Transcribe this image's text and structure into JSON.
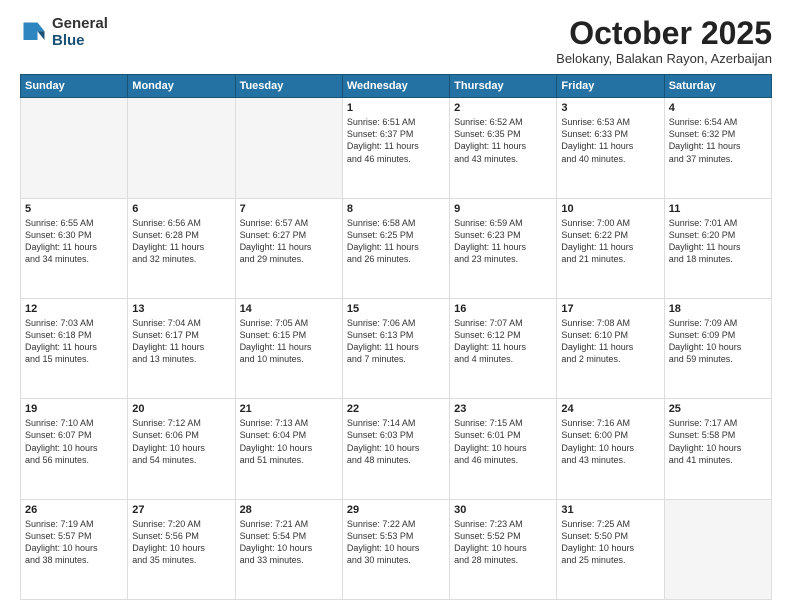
{
  "logo": {
    "general": "General",
    "blue": "Blue"
  },
  "header": {
    "month": "October 2025",
    "location": "Belokany, Balakan Rayon, Azerbaijan"
  },
  "days_of_week": [
    "Sunday",
    "Monday",
    "Tuesday",
    "Wednesday",
    "Thursday",
    "Friday",
    "Saturday"
  ],
  "weeks": [
    [
      {
        "day": "",
        "info": ""
      },
      {
        "day": "",
        "info": ""
      },
      {
        "day": "",
        "info": ""
      },
      {
        "day": "1",
        "info": "Sunrise: 6:51 AM\nSunset: 6:37 PM\nDaylight: 11 hours\nand 46 minutes."
      },
      {
        "day": "2",
        "info": "Sunrise: 6:52 AM\nSunset: 6:35 PM\nDaylight: 11 hours\nand 43 minutes."
      },
      {
        "day": "3",
        "info": "Sunrise: 6:53 AM\nSunset: 6:33 PM\nDaylight: 11 hours\nand 40 minutes."
      },
      {
        "day": "4",
        "info": "Sunrise: 6:54 AM\nSunset: 6:32 PM\nDaylight: 11 hours\nand 37 minutes."
      }
    ],
    [
      {
        "day": "5",
        "info": "Sunrise: 6:55 AM\nSunset: 6:30 PM\nDaylight: 11 hours\nand 34 minutes."
      },
      {
        "day": "6",
        "info": "Sunrise: 6:56 AM\nSunset: 6:28 PM\nDaylight: 11 hours\nand 32 minutes."
      },
      {
        "day": "7",
        "info": "Sunrise: 6:57 AM\nSunset: 6:27 PM\nDaylight: 11 hours\nand 29 minutes."
      },
      {
        "day": "8",
        "info": "Sunrise: 6:58 AM\nSunset: 6:25 PM\nDaylight: 11 hours\nand 26 minutes."
      },
      {
        "day": "9",
        "info": "Sunrise: 6:59 AM\nSunset: 6:23 PM\nDaylight: 11 hours\nand 23 minutes."
      },
      {
        "day": "10",
        "info": "Sunrise: 7:00 AM\nSunset: 6:22 PM\nDaylight: 11 hours\nand 21 minutes."
      },
      {
        "day": "11",
        "info": "Sunrise: 7:01 AM\nSunset: 6:20 PM\nDaylight: 11 hours\nand 18 minutes."
      }
    ],
    [
      {
        "day": "12",
        "info": "Sunrise: 7:03 AM\nSunset: 6:18 PM\nDaylight: 11 hours\nand 15 minutes."
      },
      {
        "day": "13",
        "info": "Sunrise: 7:04 AM\nSunset: 6:17 PM\nDaylight: 11 hours\nand 13 minutes."
      },
      {
        "day": "14",
        "info": "Sunrise: 7:05 AM\nSunset: 6:15 PM\nDaylight: 11 hours\nand 10 minutes."
      },
      {
        "day": "15",
        "info": "Sunrise: 7:06 AM\nSunset: 6:13 PM\nDaylight: 11 hours\nand 7 minutes."
      },
      {
        "day": "16",
        "info": "Sunrise: 7:07 AM\nSunset: 6:12 PM\nDaylight: 11 hours\nand 4 minutes."
      },
      {
        "day": "17",
        "info": "Sunrise: 7:08 AM\nSunset: 6:10 PM\nDaylight: 11 hours\nand 2 minutes."
      },
      {
        "day": "18",
        "info": "Sunrise: 7:09 AM\nSunset: 6:09 PM\nDaylight: 10 hours\nand 59 minutes."
      }
    ],
    [
      {
        "day": "19",
        "info": "Sunrise: 7:10 AM\nSunset: 6:07 PM\nDaylight: 10 hours\nand 56 minutes."
      },
      {
        "day": "20",
        "info": "Sunrise: 7:12 AM\nSunset: 6:06 PM\nDaylight: 10 hours\nand 54 minutes."
      },
      {
        "day": "21",
        "info": "Sunrise: 7:13 AM\nSunset: 6:04 PM\nDaylight: 10 hours\nand 51 minutes."
      },
      {
        "day": "22",
        "info": "Sunrise: 7:14 AM\nSunset: 6:03 PM\nDaylight: 10 hours\nand 48 minutes."
      },
      {
        "day": "23",
        "info": "Sunrise: 7:15 AM\nSunset: 6:01 PM\nDaylight: 10 hours\nand 46 minutes."
      },
      {
        "day": "24",
        "info": "Sunrise: 7:16 AM\nSunset: 6:00 PM\nDaylight: 10 hours\nand 43 minutes."
      },
      {
        "day": "25",
        "info": "Sunrise: 7:17 AM\nSunset: 5:58 PM\nDaylight: 10 hours\nand 41 minutes."
      }
    ],
    [
      {
        "day": "26",
        "info": "Sunrise: 7:19 AM\nSunset: 5:57 PM\nDaylight: 10 hours\nand 38 minutes."
      },
      {
        "day": "27",
        "info": "Sunrise: 7:20 AM\nSunset: 5:56 PM\nDaylight: 10 hours\nand 35 minutes."
      },
      {
        "day": "28",
        "info": "Sunrise: 7:21 AM\nSunset: 5:54 PM\nDaylight: 10 hours\nand 33 minutes."
      },
      {
        "day": "29",
        "info": "Sunrise: 7:22 AM\nSunset: 5:53 PM\nDaylight: 10 hours\nand 30 minutes."
      },
      {
        "day": "30",
        "info": "Sunrise: 7:23 AM\nSunset: 5:52 PM\nDaylight: 10 hours\nand 28 minutes."
      },
      {
        "day": "31",
        "info": "Sunrise: 7:25 AM\nSunset: 5:50 PM\nDaylight: 10 hours\nand 25 minutes."
      },
      {
        "day": "",
        "info": ""
      }
    ]
  ]
}
